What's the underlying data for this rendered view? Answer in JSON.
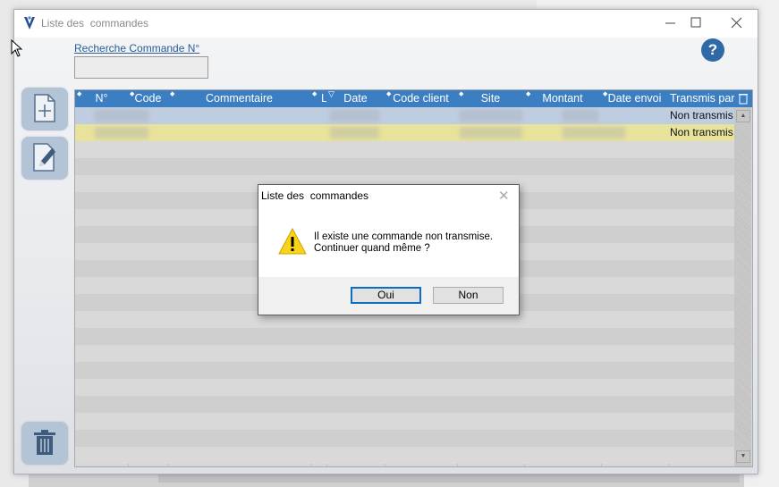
{
  "window": {
    "title": "Liste des  commandes",
    "controls": {
      "minimize": "—",
      "maximize": "☐",
      "close": "✕"
    }
  },
  "search": {
    "label": "Recherche Commande N°",
    "value": ""
  },
  "help": {
    "label": "?"
  },
  "toolbar": {
    "add": {
      "icon": "add-document-icon"
    },
    "edit": {
      "icon": "edit-document-icon"
    },
    "delete": {
      "icon": "trash-icon"
    }
  },
  "grid": {
    "columns": [
      "N°",
      "Code",
      "Commentaire",
      "L",
      "Date",
      "Code client",
      "Site",
      "Montant",
      "Date envoi",
      "Transmis par"
    ],
    "rows": [
      {
        "transmis": "Non transmis",
        "selected": false
      },
      {
        "transmis": "Non transmis",
        "selected": true
      }
    ],
    "colors": {
      "header": "#3b7ec2",
      "selected_row": "#e8e39c",
      "first_row": "#bfcde0"
    }
  },
  "dialog": {
    "title": "Liste des  commandes",
    "close": "✕",
    "icon": "warning-icon",
    "message_line1": "Il existe une commande non transmise.",
    "message_line2": "Continuer quand même ?",
    "ok_label": "Oui",
    "cancel_label": "Non"
  }
}
